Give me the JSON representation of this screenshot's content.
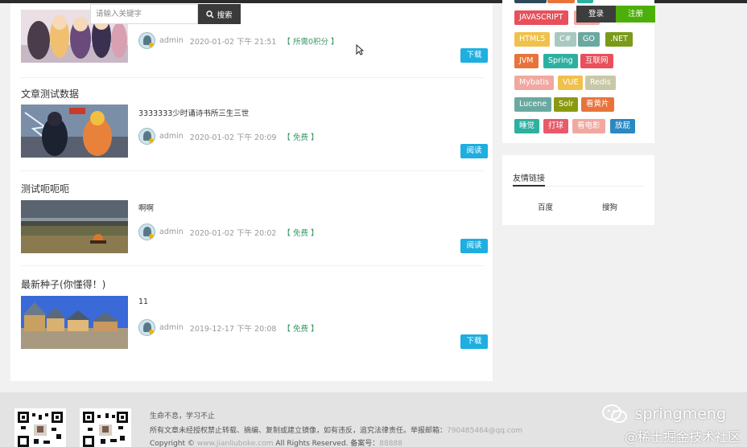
{
  "search": {
    "placeholder": "请输入关键字",
    "button": "搜索"
  },
  "posts": [
    {
      "title": "",
      "excerpt": "",
      "author": "admin",
      "date": "2020-01-02 下午 21:51",
      "cost": "【 所需0积分 】",
      "action": "下载"
    },
    {
      "title": "文章测试数据",
      "excerpt": "3333333少时诵诗书所三生三世",
      "author": "admin",
      "date": "2020-01-02 下午 20:09",
      "cost": "【 免费 】",
      "action": "阅读"
    },
    {
      "title": "测试呃呃呃",
      "excerpt": "啊啊",
      "author": "admin",
      "date": "2020-01-02 下午 20:02",
      "cost": "【 免费 】",
      "action": "阅读"
    },
    {
      "title": "最新种子(你懂得！)",
      "excerpt": "11",
      "author": "admin",
      "date": "2019-12-17 下午 20:08",
      "cost": "【 免费 】",
      "action": "下载"
    }
  ],
  "auth": {
    "login": "登录",
    "register": "注册"
  },
  "tags": [
    {
      "label": "JAVASCRIPT",
      "color": "#e8505b"
    },
    {
      "label": "HTML5",
      "color": "#f0c14b"
    },
    {
      "label": "C#",
      "color": "#a8c8c0"
    },
    {
      "label": "GO",
      "color": "#6aa9a0"
    },
    {
      "label": ".NET",
      "color": "#7a9a1a"
    },
    {
      "label": "JVM",
      "color": "#e8743c"
    },
    {
      "label": "Spring",
      "color": "#2db0a0"
    },
    {
      "label": "互联网",
      "color": "#e8505b"
    },
    {
      "label": "Mybatis",
      "color": "#f0a8a0"
    },
    {
      "label": "VUE",
      "color": "#f0c14b"
    },
    {
      "label": "Redis",
      "color": "#c8c8a8"
    },
    {
      "label": "Lucene",
      "color": "#6aa9a0"
    },
    {
      "label": "Solr",
      "color": "#8a9a10"
    },
    {
      "label": "看黄片",
      "color": "#e8743c"
    },
    {
      "label": "睡觉",
      "color": "#2db0a0"
    },
    {
      "label": "打球",
      "color": "#e85a6a"
    },
    {
      "label": "看电影",
      "color": "#f0a8a0"
    },
    {
      "label": "放屁",
      "color": "#2b88c0"
    }
  ],
  "links": {
    "heading": "友情链接",
    "items": [
      "百度",
      "搜狗"
    ]
  },
  "footer": {
    "line1": "生命不息，学习不止",
    "line2": "所有文章未经授权禁止转载、摘编、复制或建立镜像，如有违反，追究法律责任。举报邮箱：",
    "email": "790485464@qq.com",
    "line3a": "Copyright ©",
    "site": "www.jianliuboke.com",
    "line3b": "All Rights Reserved. 备案号：",
    "icp": "88888"
  },
  "watermark": {
    "name": "springmeng",
    "community": "@稀土掘金技术社区"
  },
  "colors": {
    "accent": "#1eaee0",
    "login": "#3d3d3d",
    "register": "#4caf0a"
  }
}
